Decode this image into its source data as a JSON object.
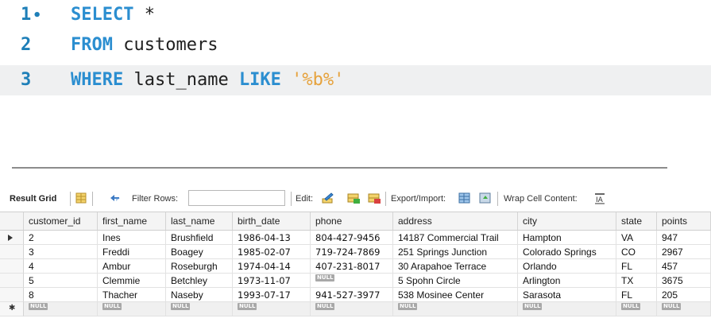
{
  "editor": {
    "lines": [
      {
        "num": "1",
        "bullet": "•",
        "kw": "SELECT",
        "rest": " *",
        "current": false
      },
      {
        "num": "2",
        "bullet": "",
        "kw": "FROM",
        "rest": " customers",
        "current": false
      },
      {
        "num": "3",
        "bullet": "",
        "kw": "WHERE",
        "rest": " last_name ",
        "kw2": "LIKE",
        "str": " '%b%'",
        "current": true
      }
    ]
  },
  "toolbar": {
    "result_grid": "Result Grid",
    "filter_rows": "Filter Rows:",
    "filter_value": "",
    "edit": "Edit:",
    "export_import": "Export/Import:",
    "wrap_cell": "Wrap Cell Content:"
  },
  "grid": {
    "columns": [
      "customer_id",
      "first_name",
      "last_name",
      "birth_date",
      "phone",
      "address",
      "city",
      "state",
      "points"
    ],
    "rows": [
      [
        "2",
        "Ines",
        "Brushfield",
        "1986-04-13",
        "804-427-9456",
        "14187 Commercial Trail",
        "Hampton",
        "VA",
        "947"
      ],
      [
        "3",
        "Freddi",
        "Boagey",
        "1985-02-07",
        "719-724-7869",
        "251 Springs Junction",
        "Colorado Springs",
        "CO",
        "2967"
      ],
      [
        "4",
        "Ambur",
        "Roseburgh",
        "1974-04-14",
        "407-231-8017",
        "30 Arapahoe Terrace",
        "Orlando",
        "FL",
        "457"
      ],
      [
        "5",
        "Clemmie",
        "Betchley",
        "1973-11-07",
        "NULL",
        "5 Spohn Circle",
        "Arlington",
        "TX",
        "3675"
      ],
      [
        "8",
        "Thacher",
        "Naseby",
        "1993-07-17",
        "941-527-3977",
        "538 Mosinee Center",
        "Sarasota",
        "FL",
        "205"
      ]
    ],
    "null_label": "NULL"
  },
  "colors": {
    "keyword": "#2b8ed0",
    "string": "#e6a23c",
    "line_number": "#1e7fb8",
    "current_line": "#eff0f1"
  }
}
